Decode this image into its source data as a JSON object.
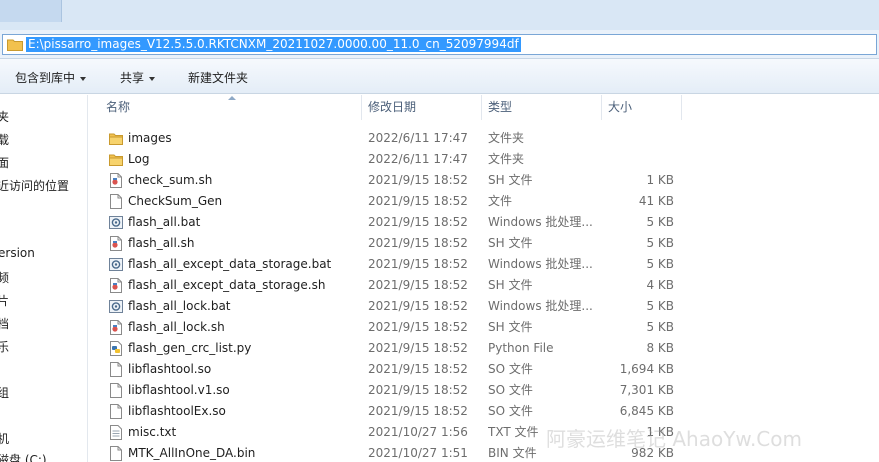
{
  "window": {
    "tab_text": ""
  },
  "address": {
    "path": "E:\\pissarro_images_V12.5.5.0.RKTCNXM_20211027.0000.00_11.0_cn_52097994df"
  },
  "toolbar": {
    "include": "包含到库中",
    "share": "共享",
    "new_folder": "新建文件夹"
  },
  "nav": [
    {
      "label": "夹"
    },
    {
      "label": "载"
    },
    {
      "label": "面"
    },
    {
      "label": "近访问的位置"
    },
    {
      "label": ""
    },
    {
      "label": ""
    },
    {
      "label": "ersion"
    },
    {
      "label": "频"
    },
    {
      "label": "片"
    },
    {
      "label": "档"
    },
    {
      "label": "乐"
    },
    {
      "label": ""
    },
    {
      "label": "组"
    },
    {
      "label": ""
    },
    {
      "label": "机"
    },
    {
      "label": "磁盘 (C:)"
    }
  ],
  "columns": {
    "name": "名称",
    "date": "修改日期",
    "type": "类型",
    "size": "大小"
  },
  "files": [
    {
      "name": "images",
      "date": "2022/6/11 17:47",
      "type": "文件夹",
      "size": "",
      "icon": "folder-icon"
    },
    {
      "name": "Log",
      "date": "2022/6/11 17:47",
      "type": "文件夹",
      "size": "",
      "icon": "folder-icon"
    },
    {
      "name": "check_sum.sh",
      "date": "2021/9/15 18:52",
      "type": "SH 文件",
      "size": "1 KB",
      "icon": "sh-file-icon"
    },
    {
      "name": "CheckSum_Gen",
      "date": "2021/9/15 18:52",
      "type": "文件",
      "size": "41 KB",
      "icon": "file-icon"
    },
    {
      "name": "flash_all.bat",
      "date": "2021/9/15 18:52",
      "type": "Windows 批处理...",
      "size": "5 KB",
      "icon": "bat-file-icon"
    },
    {
      "name": "flash_all.sh",
      "date": "2021/9/15 18:52",
      "type": "SH 文件",
      "size": "5 KB",
      "icon": "sh-file-icon"
    },
    {
      "name": "flash_all_except_data_storage.bat",
      "date": "2021/9/15 18:52",
      "type": "Windows 批处理...",
      "size": "5 KB",
      "icon": "bat-file-icon"
    },
    {
      "name": "flash_all_except_data_storage.sh",
      "date": "2021/9/15 18:52",
      "type": "SH 文件",
      "size": "4 KB",
      "icon": "sh-file-icon"
    },
    {
      "name": "flash_all_lock.bat",
      "date": "2021/9/15 18:52",
      "type": "Windows 批处理...",
      "size": "5 KB",
      "icon": "bat-file-icon"
    },
    {
      "name": "flash_all_lock.sh",
      "date": "2021/9/15 18:52",
      "type": "SH 文件",
      "size": "5 KB",
      "icon": "sh-file-icon"
    },
    {
      "name": "flash_gen_crc_list.py",
      "date": "2021/9/15 18:52",
      "type": "Python File",
      "size": "8 KB",
      "icon": "python-file-icon"
    },
    {
      "name": "libflashtool.so",
      "date": "2021/9/15 18:52",
      "type": "SO 文件",
      "size": "1,694 KB",
      "icon": "file-icon"
    },
    {
      "name": "libflashtool.v1.so",
      "date": "2021/9/15 18:52",
      "type": "SO 文件",
      "size": "7,301 KB",
      "icon": "file-icon"
    },
    {
      "name": "libflashtoolEx.so",
      "date": "2021/9/15 18:52",
      "type": "SO 文件",
      "size": "6,845 KB",
      "icon": "file-icon"
    },
    {
      "name": "misc.txt",
      "date": "2021/10/27 1:56",
      "type": "TXT 文件",
      "size": "1 KB",
      "icon": "txt-file-icon"
    },
    {
      "name": "MTK_AllInOne_DA.bin",
      "date": "2021/10/27 1:51",
      "type": "BIN 文件",
      "size": "982 KB",
      "icon": "file-icon"
    }
  ],
  "watermark": "阿豪运维笔记 AhaoYw.Com",
  "colors": {
    "selection": "#3399ff",
    "folder": "#f2c14e",
    "header_text": "#4c607a"
  }
}
